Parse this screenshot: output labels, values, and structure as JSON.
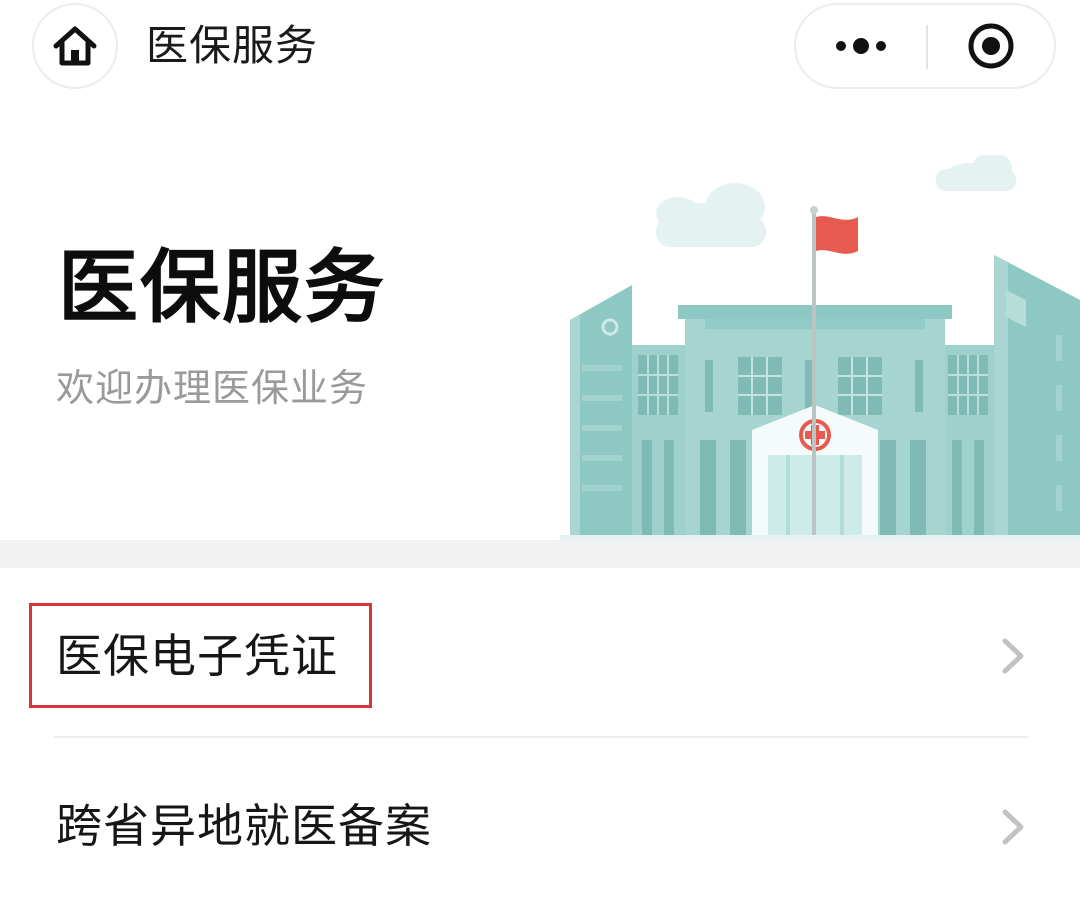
{
  "navbar": {
    "title": "医保服务",
    "home_icon": "home-icon",
    "more_icon": "more-dots-icon",
    "close_icon": "target-close-icon"
  },
  "hero": {
    "title": "医保服务",
    "subtitle": "欢迎办理医保业务"
  },
  "list": {
    "items": [
      {
        "label": "医保电子凭证",
        "highlighted": true
      },
      {
        "label": "跨省异地就医备案",
        "highlighted": false
      }
    ]
  },
  "colors": {
    "highlight_border": "#d8343c",
    "building_teal": "#8ec8c3",
    "flag_red": "#e85a4f"
  }
}
